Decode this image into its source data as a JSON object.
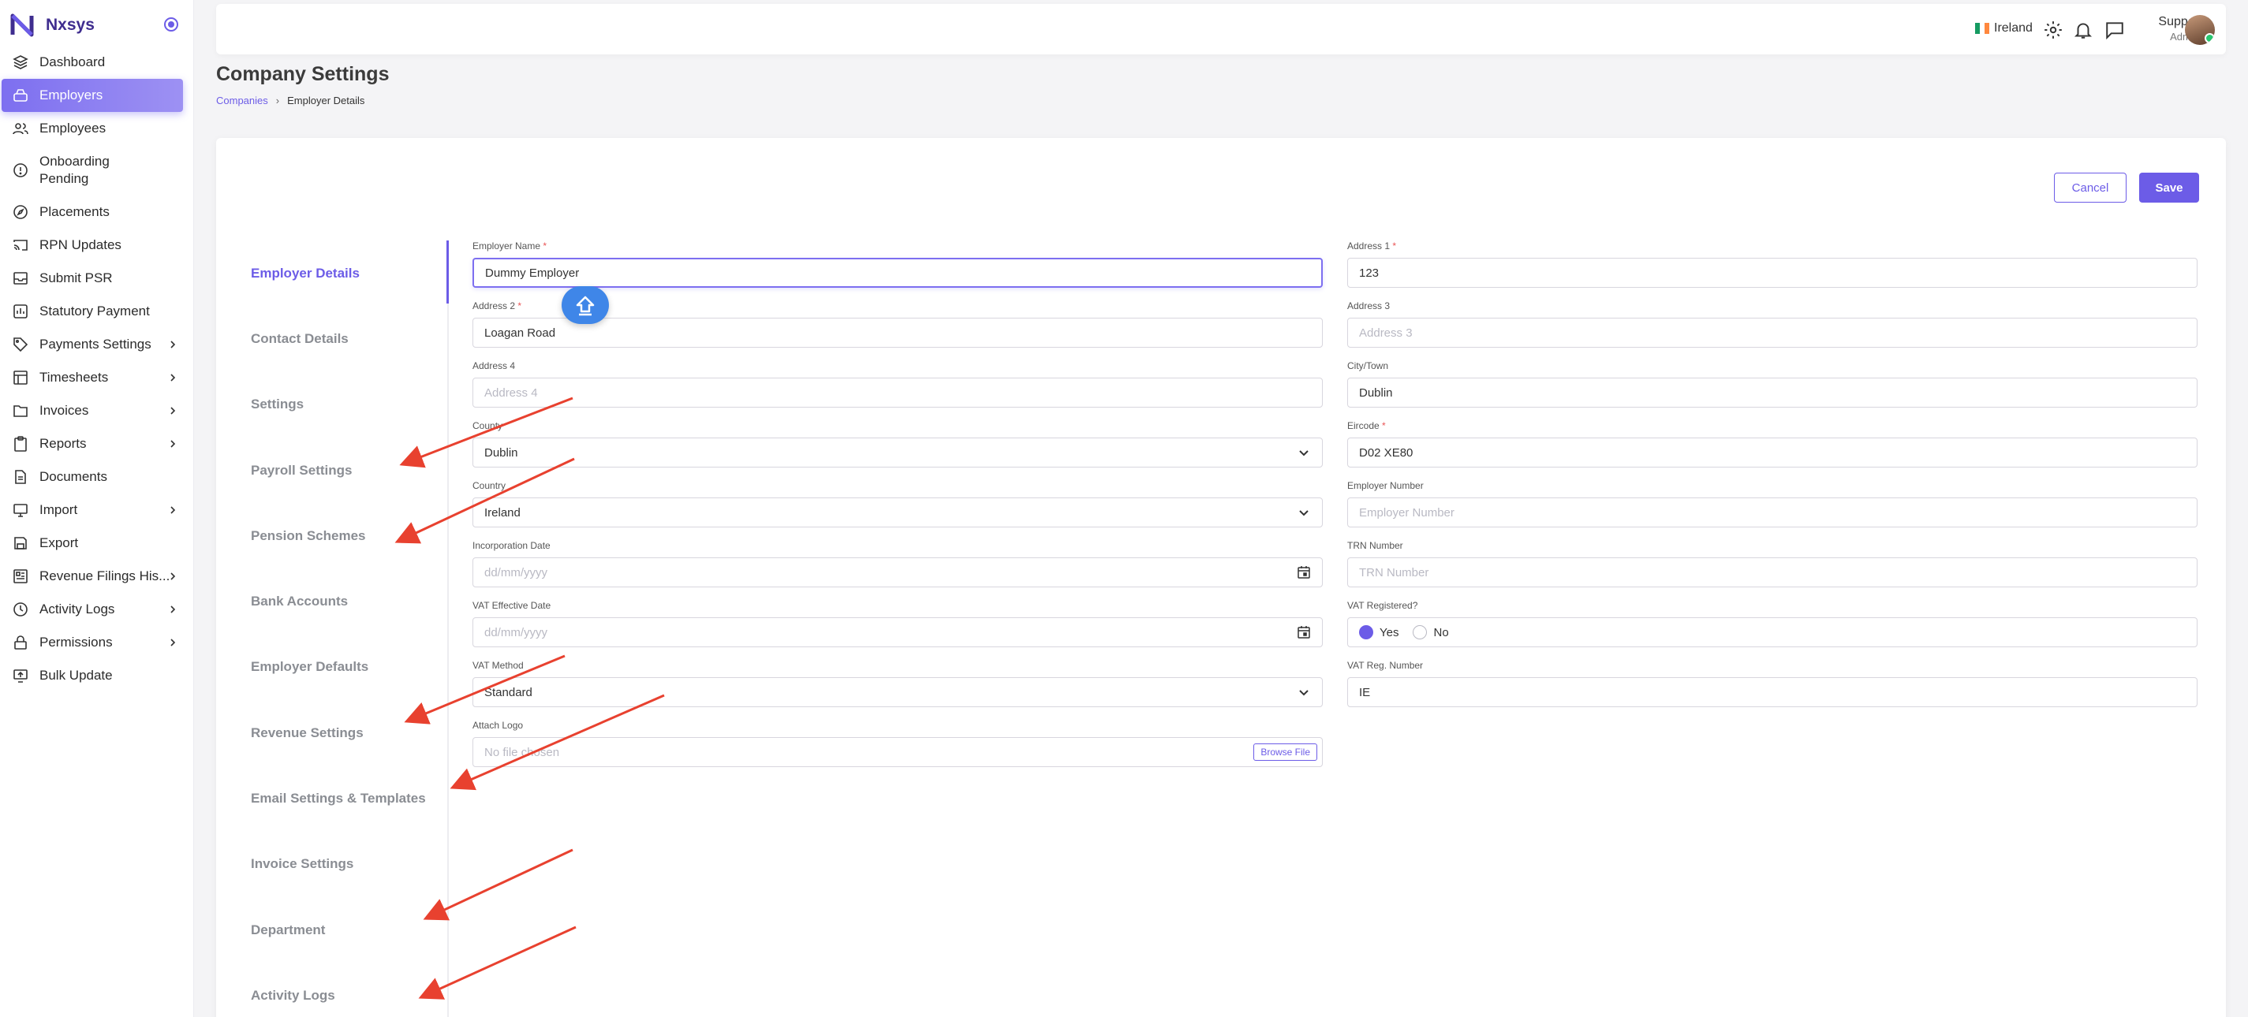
{
  "brand": {
    "name": "Nxsys"
  },
  "sidebar": {
    "items": [
      {
        "label": "Dashboard",
        "icon": "layers-icon",
        "chevron": false
      },
      {
        "label": "Employers",
        "icon": "building-icon",
        "chevron": false,
        "active": true
      },
      {
        "label": "Employees",
        "icon": "users-icon",
        "chevron": false
      },
      {
        "label": "Onboarding Pending",
        "icon": "alert-circle-icon",
        "chevron": false
      },
      {
        "label": "Placements",
        "icon": "compass-icon",
        "chevron": false
      },
      {
        "label": "RPN Updates",
        "icon": "cast-icon",
        "chevron": false
      },
      {
        "label": "Submit PSR",
        "icon": "inbox-icon",
        "chevron": false
      },
      {
        "label": "Statutory Payment",
        "icon": "statutory-icon",
        "chevron": false
      },
      {
        "label": "Payments Settings",
        "icon": "tag-icon",
        "chevron": true
      },
      {
        "label": "Timesheets",
        "icon": "grid-icon",
        "chevron": true
      },
      {
        "label": "Invoices",
        "icon": "folder-icon",
        "chevron": true
      },
      {
        "label": "Reports",
        "icon": "clipboard-icon",
        "chevron": true
      },
      {
        "label": "Documents",
        "icon": "file-icon",
        "chevron": false
      },
      {
        "label": "Import",
        "icon": "monitor-icon",
        "chevron": true
      },
      {
        "label": "Export",
        "icon": "save-icon",
        "chevron": false
      },
      {
        "label": "Revenue Filings His...",
        "icon": "calendar-grid-icon",
        "chevron": true
      },
      {
        "label": "Activity Logs",
        "icon": "clock-icon",
        "chevron": true
      },
      {
        "label": "Permissions",
        "icon": "lock-icon",
        "chevron": true
      },
      {
        "label": "Bulk Update",
        "icon": "screen-upload-icon",
        "chevron": false
      }
    ]
  },
  "topbar": {
    "country": "Ireland",
    "user_name": "Supper",
    "user_role": "Admin"
  },
  "page": {
    "title": "Company Settings",
    "breadcrumb_link": "Companies",
    "breadcrumb_current": "Employer Details"
  },
  "actions": {
    "cancel": "Cancel",
    "save": "Save"
  },
  "tabs": [
    "Employer Details",
    "Contact Details",
    "Settings",
    "Payroll Settings",
    "Pension Schemes",
    "Bank Accounts",
    "Employer Defaults",
    "Revenue Settings",
    "Email Settings & Templates",
    "Invoice Settings",
    "Department",
    "Activity Logs"
  ],
  "form": {
    "employer_name": {
      "label": "Employer Name",
      "value": "Dummy Employer"
    },
    "address1": {
      "label": "Address 1",
      "value": "123"
    },
    "address2": {
      "label": "Address 2",
      "value": "Loagan Road"
    },
    "address3": {
      "label": "Address 3",
      "placeholder": "Address 3"
    },
    "address4": {
      "label": "Address 4",
      "placeholder": "Address 4"
    },
    "city": {
      "label": "City/Town",
      "value": "Dublin"
    },
    "county": {
      "label": "County",
      "value": "Dublin"
    },
    "eircode": {
      "label": "Eircode",
      "value": "D02 XE80"
    },
    "country": {
      "label": "Country",
      "value": "Ireland"
    },
    "employer_number": {
      "label": "Employer Number",
      "placeholder": "Employer Number"
    },
    "incorporation_date": {
      "label": "Incorporation Date",
      "placeholder": "dd/mm/yyyy"
    },
    "trn_number": {
      "label": "TRN Number",
      "placeholder": "TRN Number"
    },
    "vat_effective_date": {
      "label": "VAT Effective Date",
      "placeholder": "dd/mm/yyyy"
    },
    "vat_registered": {
      "label": "VAT Registered?",
      "yes": "Yes",
      "no": "No"
    },
    "vat_method": {
      "label": "VAT Method",
      "value": "Standard"
    },
    "vat_reg_number": {
      "label": "VAT Reg. Number",
      "value": "IE"
    },
    "attach_logo": {
      "label": "Attach Logo",
      "placeholder": "No file chosen",
      "button": "Browse File"
    }
  },
  "colors": {
    "accent": "#6c5ce7",
    "annotation": "#e8412f"
  }
}
